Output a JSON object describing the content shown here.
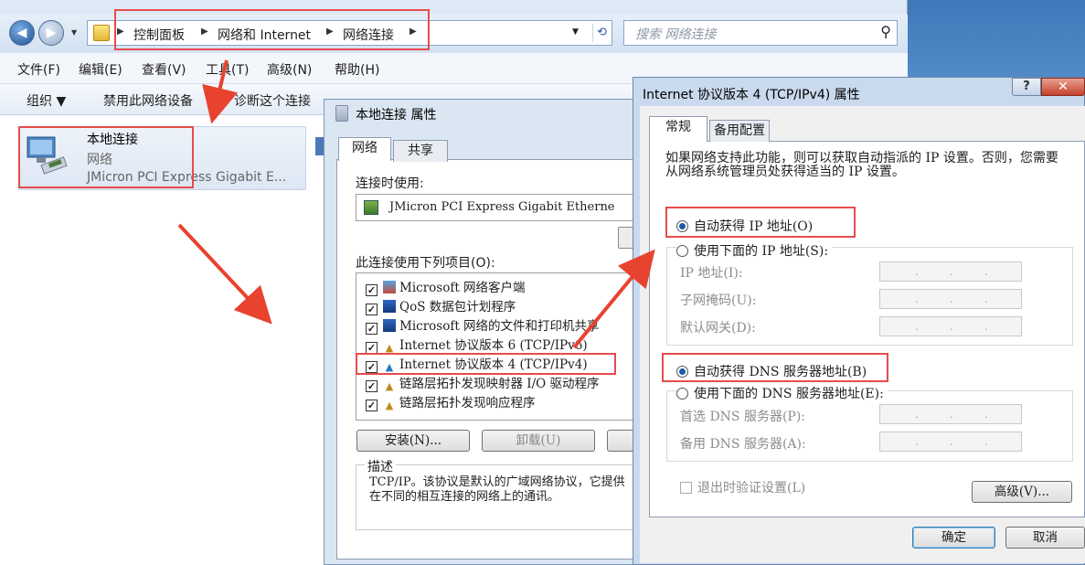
{
  "explorer": {
    "breadcrumb": [
      "控制面板",
      "网络和 Internet",
      "网络连接"
    ],
    "search_placeholder": "搜索 网络连接",
    "menu": [
      "文件(F)",
      "编辑(E)",
      "查看(V)",
      "工具(T)",
      "高级(N)",
      "帮助(H)"
    ],
    "toolbar": [
      "组织 ▼",
      "禁用此网络设备",
      "诊断这个连接"
    ],
    "connection": {
      "name": "本地连接",
      "type": "网络",
      "device": "JMicron PCI Express Gigabit E..."
    }
  },
  "local_props": {
    "title": "本地连接 属性",
    "tabs": [
      "网络",
      "共享"
    ],
    "connect_using_label": "连接时使用:",
    "adapter": "JMicron PCI Express Gigabit Etherne",
    "items_label": "此连接使用下列项目(O):",
    "items": [
      {
        "label": "Microsoft 网络客户端",
        "checked": true,
        "icon": "network-client-icon"
      },
      {
        "label": "QoS 数据包计划程序",
        "checked": true,
        "icon": "qos-icon"
      },
      {
        "label": "Microsoft 网络的文件和打印机共享",
        "checked": true,
        "icon": "file-share-icon"
      },
      {
        "label": "Internet 协议版本 6 (TCP/IPv6)",
        "checked": true,
        "icon": "protocol-icon"
      },
      {
        "label": "Internet 协议版本 4 (TCP/IPv4)",
        "checked": true,
        "icon": "protocol-icon"
      },
      {
        "label": "链路层拓扑发现映射器 I/O 驱动程序",
        "checked": true,
        "icon": "protocol-icon"
      },
      {
        "label": "链路层拓扑发现响应程序",
        "checked": true,
        "icon": "protocol-icon"
      }
    ],
    "install_label": "安装(N)...",
    "uninstall_label": "卸载(U)",
    "description_label": "描述",
    "description": "TCP/IP。该协议是默认的广域网络协议，它提供在不同的相互连接的网络上的通讯。"
  },
  "ipv4": {
    "title": "Internet 协议版本 4 (TCP/IPv4) 属性",
    "help_label": "?",
    "close_label": "✕",
    "tabs": [
      "常规",
      "备用配置"
    ],
    "intro": "如果网络支持此功能，则可以获取自动指派的 IP 设置。否则，您需要从网络系统管理员处获得适当的 IP 设置。",
    "auto_ip_label": "自动获得 IP 地址(O)",
    "manual_ip_label": "使用下面的 IP 地址(S):",
    "ip_label": "IP 地址(I):",
    "mask_label": "子网掩码(U):",
    "gateway_label": "默认网关(D):",
    "auto_dns_label": "自动获得 DNS 服务器地址(B)",
    "manual_dns_label": "使用下面的 DNS 服务器地址(E):",
    "pref_dns_label": "首选 DNS 服务器(P):",
    "alt_dns_label": "备用 DNS 服务器(A):",
    "exit_validate_label": "退出时验证设置(L)",
    "advanced_label": "高级(V)...",
    "ok_label": "确定",
    "cancel_label": "取消",
    "ip_mode": "auto",
    "dns_mode": "auto"
  },
  "colors": {
    "highlight": "#e74c4c",
    "arrow": "#e8432f"
  }
}
